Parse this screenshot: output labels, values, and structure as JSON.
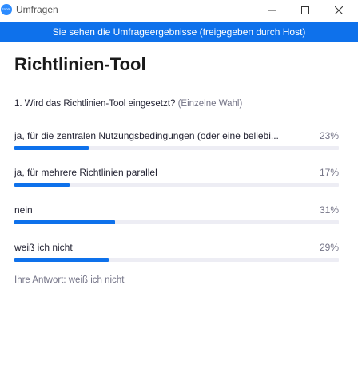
{
  "window": {
    "title": "Umfragen",
    "icon_text": "zoom"
  },
  "banner": "Sie sehen die Umfrageergebnisse (freigegeben durch Host)",
  "poll": {
    "title": "Richtlinien-Tool",
    "question": "1. Wird das Richtlinien-Tool eingesetzt?",
    "question_hint": "(Einzelne Wahl)",
    "options": [
      {
        "label": "ja, für die zentralen Nutzungsbedingungen (oder eine beliebi...",
        "percent_text": "23%",
        "percent": 23
      },
      {
        "label": "ja, für mehrere Richtlinien parallel",
        "percent_text": "17%",
        "percent": 17
      },
      {
        "label": "nein",
        "percent_text": "31%",
        "percent": 31
      },
      {
        "label": "weiß ich nicht",
        "percent_text": "29%",
        "percent": 29
      }
    ],
    "your_answer": "Ihre Antwort: weiß ich nicht"
  },
  "colors": {
    "accent": "#0E71EB",
    "track": "#ededf4"
  }
}
